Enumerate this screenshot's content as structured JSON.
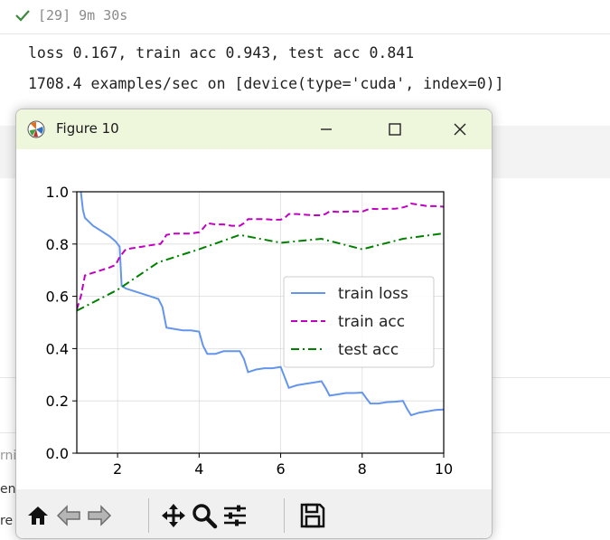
{
  "cell": {
    "exec_label": "[29] 9m 30s",
    "output_lines": [
      "loss 0.167, train acc 0.943, test acc 0.841",
      "1708.4 examples/sec on [device(type='cuda', index=0)]"
    ],
    "left_fragments": [
      "rni",
      "ene",
      "re"
    ]
  },
  "window": {
    "title": "Figure 10",
    "icons": {
      "app": "matplotlib-logo-icon",
      "minimize": "minimize-icon",
      "maximize": "maximize-icon",
      "close": "close-icon"
    },
    "titlebar_color": "#eef6dc"
  },
  "toolbar": {
    "buttons": [
      {
        "name": "home-icon"
      },
      {
        "name": "back-arrow-icon"
      },
      {
        "name": "forward-arrow-icon"
      },
      {
        "name": "pan-icon"
      },
      {
        "name": "zoom-icon"
      },
      {
        "name": "configure-subplots-icon"
      },
      {
        "name": "save-icon"
      }
    ]
  },
  "chart_data": {
    "type": "line",
    "xlim": [
      1,
      10
    ],
    "ylim": [
      0,
      1.0
    ],
    "xticks": [
      2,
      4,
      6,
      8,
      10
    ],
    "yticks": [
      0.0,
      0.2,
      0.4,
      0.6,
      0.8,
      1.0
    ],
    "xtick_labels": [
      "2",
      "4",
      "6",
      "8",
      "10"
    ],
    "ytick_labels": [
      "0.0",
      "0.2",
      "0.4",
      "0.6",
      "0.8",
      "1.0"
    ],
    "grid": true,
    "legend": "center-right",
    "series": [
      {
        "name": "train loss",
        "color": "#6495ed",
        "style": "solid",
        "x": [
          1.1,
          1.15,
          1.2,
          1.4,
          1.6,
          1.8,
          1.95,
          2.05,
          2.1,
          2.2,
          2.4,
          2.6,
          2.8,
          3.0,
          3.1,
          3.2,
          3.4,
          3.6,
          3.8,
          4.0,
          4.1,
          4.2,
          4.4,
          4.6,
          4.8,
          5.0,
          5.1,
          5.2,
          5.4,
          5.6,
          5.8,
          6.0,
          6.1,
          6.2,
          6.4,
          6.6,
          6.8,
          7.0,
          7.1,
          7.2,
          7.4,
          7.6,
          7.8,
          8.0,
          8.1,
          8.2,
          8.4,
          8.6,
          8.8,
          9.0,
          9.1,
          9.2,
          9.4,
          9.6,
          9.8,
          10.0
        ],
        "y": [
          1.0,
          0.93,
          0.9,
          0.87,
          0.85,
          0.83,
          0.81,
          0.79,
          0.64,
          0.63,
          0.62,
          0.61,
          0.6,
          0.59,
          0.56,
          0.48,
          0.475,
          0.47,
          0.47,
          0.465,
          0.41,
          0.38,
          0.38,
          0.39,
          0.39,
          0.39,
          0.36,
          0.31,
          0.32,
          0.325,
          0.325,
          0.33,
          0.29,
          0.25,
          0.26,
          0.265,
          0.27,
          0.275,
          0.25,
          0.22,
          0.225,
          0.23,
          0.23,
          0.232,
          0.21,
          0.19,
          0.19,
          0.195,
          0.197,
          0.2,
          0.17,
          0.145,
          0.155,
          0.16,
          0.165,
          0.167
        ]
      },
      {
        "name": "train acc",
        "color": "#c000c0",
        "style": "dashed",
        "x": [
          1.0,
          1.1,
          1.2,
          1.4,
          1.6,
          1.8,
          1.95,
          2.05,
          2.2,
          2.4,
          2.6,
          2.8,
          3.0,
          3.05,
          3.1,
          3.2,
          3.4,
          3.6,
          3.8,
          4.0,
          4.1,
          4.2,
          4.4,
          4.6,
          4.8,
          5.0,
          5.1,
          5.2,
          5.4,
          5.6,
          5.8,
          6.0,
          6.1,
          6.2,
          6.4,
          6.6,
          6.8,
          7.0,
          7.1,
          7.2,
          7.4,
          7.6,
          7.8,
          8.0,
          8.1,
          8.2,
          8.4,
          8.6,
          8.8,
          9.0,
          9.1,
          9.2,
          9.4,
          9.6,
          9.8,
          10.0
        ],
        "y": [
          0.55,
          0.6,
          0.68,
          0.69,
          0.7,
          0.71,
          0.72,
          0.75,
          0.78,
          0.785,
          0.79,
          0.795,
          0.8,
          0.8,
          0.81,
          0.835,
          0.84,
          0.84,
          0.84,
          0.845,
          0.86,
          0.88,
          0.875,
          0.875,
          0.87,
          0.87,
          0.88,
          0.895,
          0.895,
          0.895,
          0.893,
          0.893,
          0.9,
          0.915,
          0.915,
          0.912,
          0.91,
          0.91,
          0.915,
          0.925,
          0.923,
          0.924,
          0.925,
          0.924,
          0.93,
          0.935,
          0.934,
          0.935,
          0.935,
          0.94,
          0.945,
          0.955,
          0.95,
          0.945,
          0.945,
          0.943
        ]
      },
      {
        "name": "test acc",
        "color": "#008000",
        "style": "dashdot",
        "x": [
          1,
          2,
          3,
          4,
          5,
          6,
          7,
          8,
          9,
          10
        ],
        "y": [
          0.545,
          0.625,
          0.73,
          0.78,
          0.835,
          0.805,
          0.82,
          0.78,
          0.82,
          0.841
        ]
      }
    ]
  }
}
